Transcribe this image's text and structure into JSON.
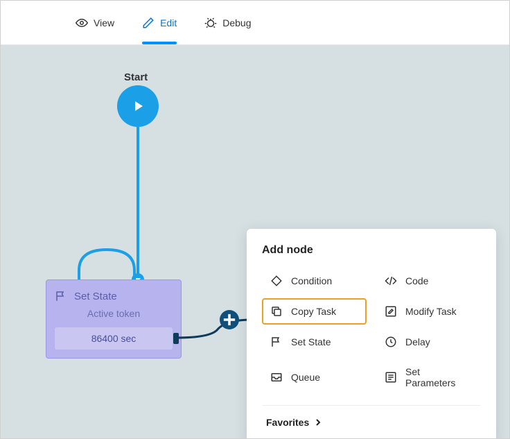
{
  "tabs": {
    "view": "View",
    "edit": "Edit",
    "debug": "Debug"
  },
  "canvas": {
    "start_label": "Start",
    "node": {
      "title": "Set State",
      "subtitle": "Active token",
      "value": "86400 sec"
    }
  },
  "popover": {
    "title": "Add node",
    "options": [
      {
        "id": "condition",
        "label": "Condition",
        "icon": "diamond"
      },
      {
        "id": "code",
        "label": "Code",
        "icon": "code"
      },
      {
        "id": "copy_task",
        "label": "Copy Task",
        "icon": "copy",
        "highlight": true
      },
      {
        "id": "modify_task",
        "label": "Modify Task",
        "icon": "pencil-box"
      },
      {
        "id": "set_state",
        "label": "Set State",
        "icon": "flag"
      },
      {
        "id": "delay",
        "label": "Delay",
        "icon": "clock"
      },
      {
        "id": "queue",
        "label": "Queue",
        "icon": "tray"
      },
      {
        "id": "set_parameters",
        "label": "Set Parameters",
        "icon": "list-box"
      }
    ],
    "favorites": "Favorites"
  }
}
